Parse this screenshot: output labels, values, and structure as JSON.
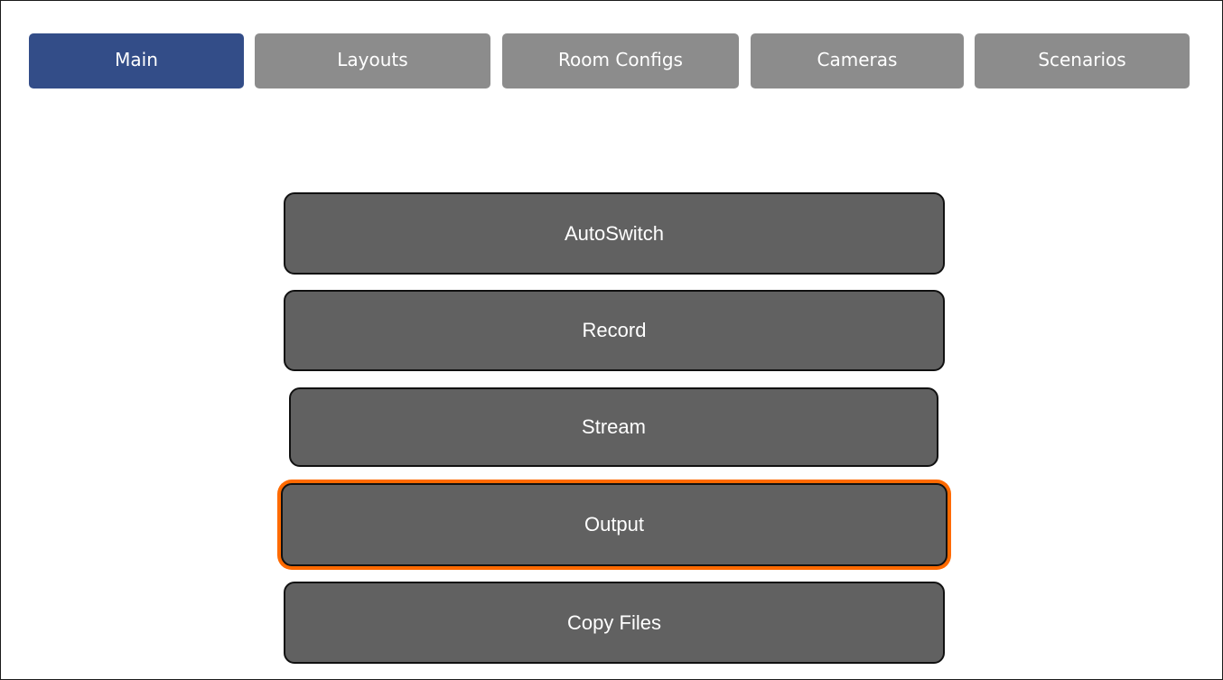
{
  "tabs": [
    {
      "label": "Main",
      "active": true
    },
    {
      "label": "Layouts",
      "active": false
    },
    {
      "label": "Room Configs",
      "active": false
    },
    {
      "label": "Cameras",
      "active": false
    },
    {
      "label": "Scenarios",
      "active": false
    }
  ],
  "actions": [
    {
      "label": "AutoSwitch",
      "focused": false
    },
    {
      "label": "Record",
      "focused": false
    },
    {
      "label": "Stream",
      "focused": false
    },
    {
      "label": "Output",
      "focused": true
    },
    {
      "label": "Copy Files",
      "focused": false
    }
  ],
  "colors": {
    "active_tab": "#334d88",
    "inactive_tab": "#8c8c8c",
    "button_fill": "#616161",
    "focus_ring": "#ff6a00"
  }
}
